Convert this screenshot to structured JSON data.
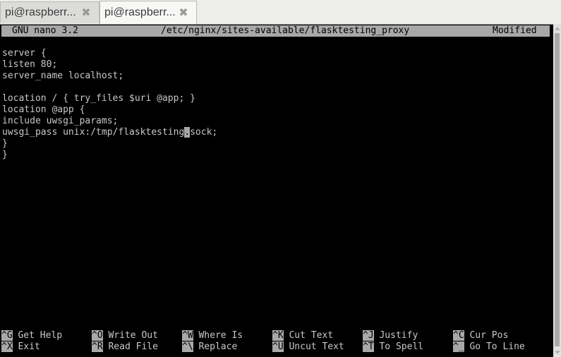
{
  "tabs": [
    {
      "label": "pi@raspberr...",
      "active": false,
      "close_icon": "close-x-icon"
    },
    {
      "label": "pi@raspberr...",
      "active": true,
      "close_icon": "close-x-icon"
    }
  ],
  "nano": {
    "app_version": "GNU nano 3.2",
    "file_path": "/etc/nginx/sites-available/flasktesting_proxy",
    "status": "Modified",
    "lines": [
      "",
      "server {",
      "listen 80;",
      "server_name localhost;",
      "",
      "location / { try_files $uri @app; }",
      "location @app {",
      "include uwsgi_params;",
      "uwsgi_pass unix:/tmp/flasktesting.sock;",
      "}",
      "}"
    ],
    "cursor_line": {
      "before": "uwsgi_pass unix:/tmp/flasktesting",
      "cursor_char": ".",
      "after": "sock;"
    },
    "shortcuts": [
      {
        "key": "^G",
        "label": "Get Help"
      },
      {
        "key": "^O",
        "label": "Write Out"
      },
      {
        "key": "^W",
        "label": "Where Is"
      },
      {
        "key": "^K",
        "label": "Cut Text"
      },
      {
        "key": "^J",
        "label": "Justify"
      },
      {
        "key": "^C",
        "label": "Cur Pos"
      },
      {
        "key": "^X",
        "label": "Exit"
      },
      {
        "key": "^R",
        "label": "Read File"
      },
      {
        "key": "^\\",
        "label": "Replace"
      },
      {
        "key": "^U",
        "label": "Uncut Text"
      },
      {
        "key": "^T",
        "label": "To Spell"
      },
      {
        "key": "^_",
        "label": "Go To Line"
      }
    ]
  },
  "colors": {
    "terminal_bg": "#000000",
    "terminal_fg": "#c8c8c8",
    "highlight_bg": "#a8a8a8"
  }
}
